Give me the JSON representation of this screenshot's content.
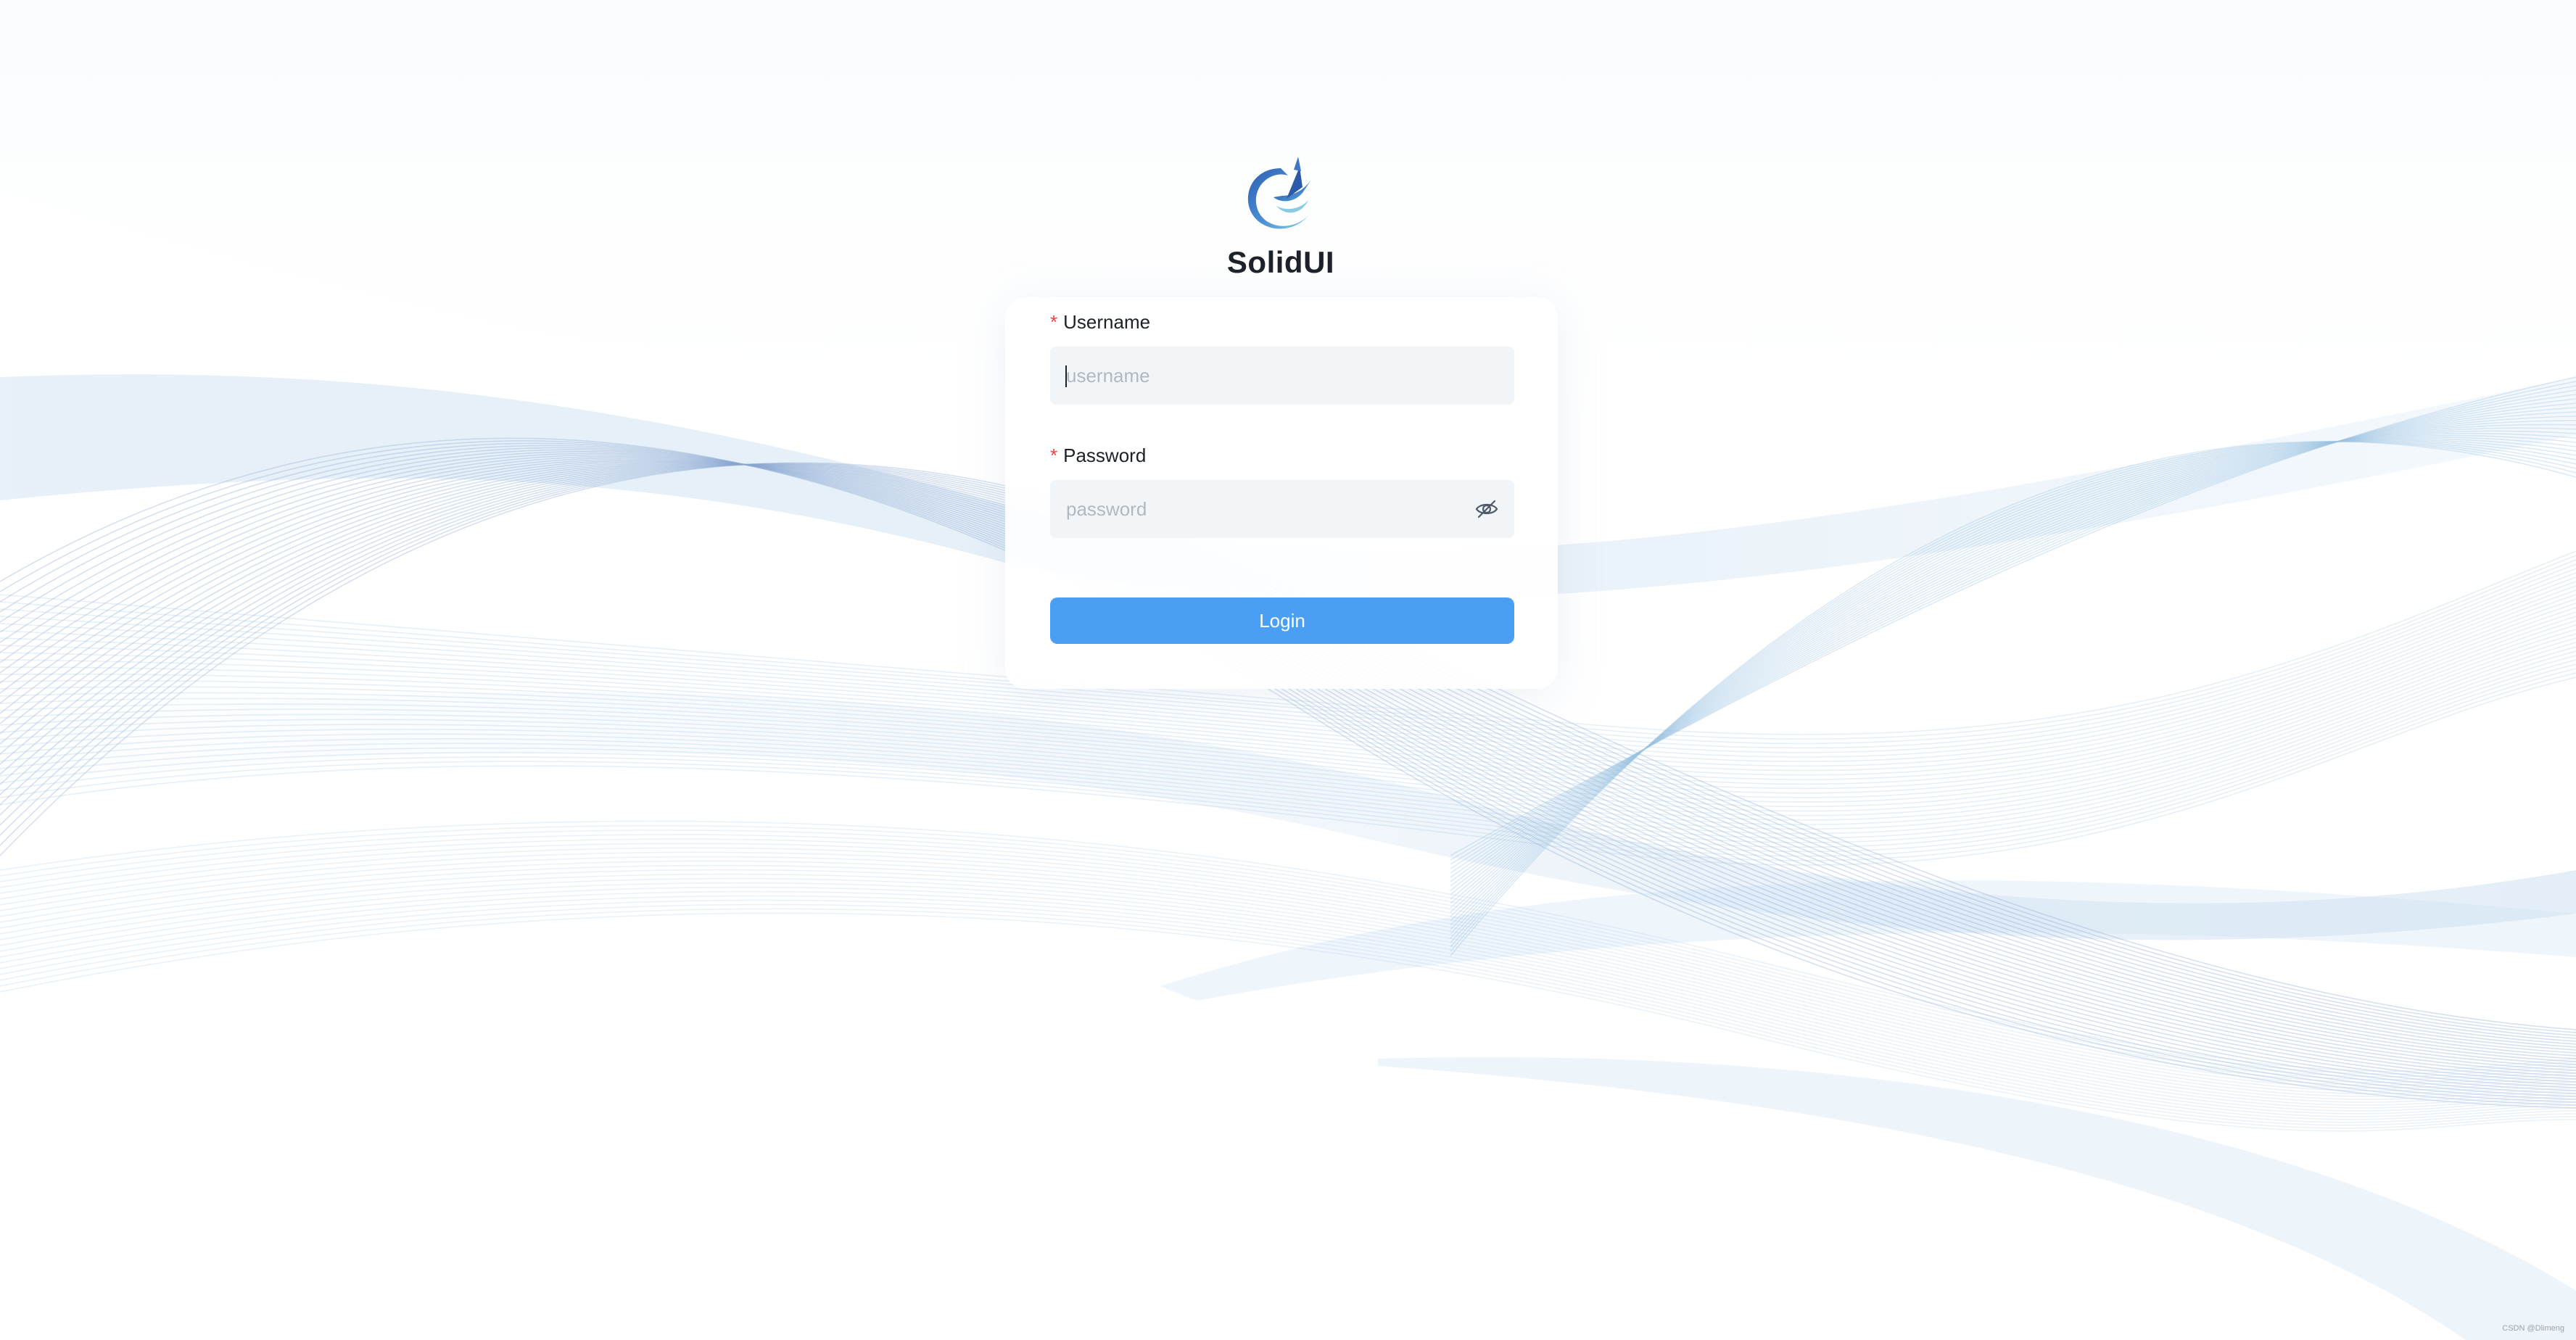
{
  "brand": {
    "name": "SolidUI",
    "logo_icon": "solidui-logo-icon"
  },
  "login_form": {
    "username": {
      "label": "Username",
      "required_mark": "*",
      "placeholder": "username",
      "value": ""
    },
    "password": {
      "label": "Password",
      "required_mark": "*",
      "placeholder": "password",
      "value": "",
      "toggle_icon": "eye-slash-icon"
    },
    "submit_label": "Login"
  },
  "colors": {
    "primary": "#4a9ff5",
    "required": "#f53f3f",
    "input_bg": "#f2f5f8",
    "wave": "#8fb6dc"
  },
  "watermark": "CSDN @Dlimeng"
}
